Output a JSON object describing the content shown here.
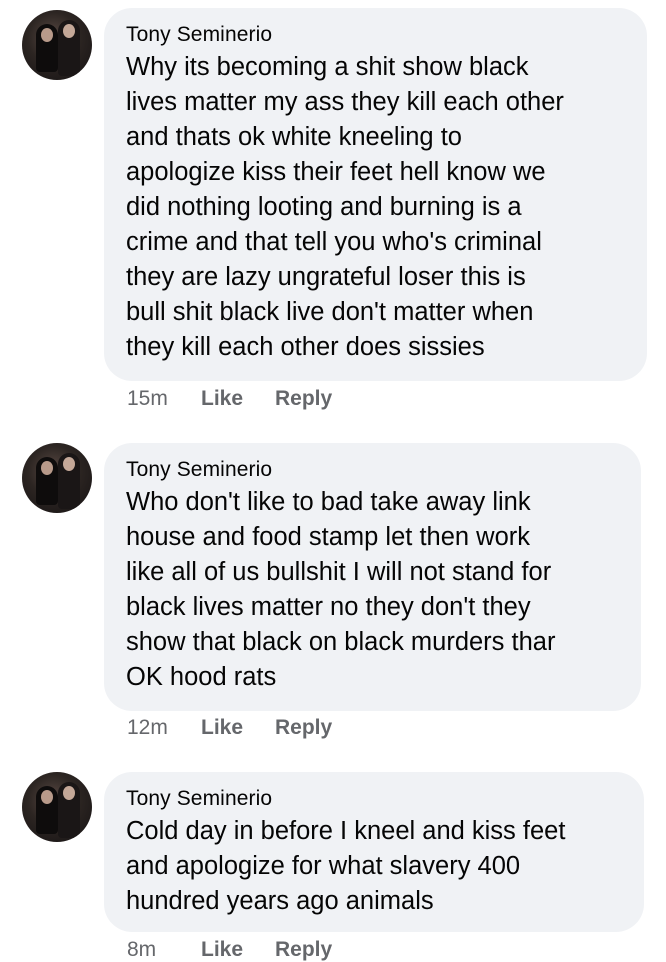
{
  "comments": [
    {
      "author": "Tony Seminerio",
      "lines": [
        "Why its becoming a shit show black",
        "lives matter my ass they kill each other",
        "and thats ok white kneeling to",
        "apologize kiss their feet hell know we",
        "did nothing looting and burning is a",
        "crime and that tell you who's criminal",
        "they are lazy ungrateful loser this is",
        "bull shit black live don't matter when",
        "they kill each other does sissies"
      ],
      "time": "15m",
      "like": "Like",
      "reply": "Reply"
    },
    {
      "author": "Tony Seminerio",
      "lines": [
        "Who don't like to bad take away link",
        "house and food stamp let then work",
        "like all of us bullshit I will not stand for",
        "black lives matter no they don't they",
        "show that black on black murders thar",
        "OK hood rats"
      ],
      "time": "12m",
      "like": "Like",
      "reply": "Reply"
    },
    {
      "author": "Tony Seminerio",
      "lines": [
        "Cold day in before I kneel and kiss feet",
        "and apologize for what slavery 400",
        "hundred years ago animals"
      ],
      "time": "8m",
      "like": "Like",
      "reply": "Reply"
    }
  ]
}
